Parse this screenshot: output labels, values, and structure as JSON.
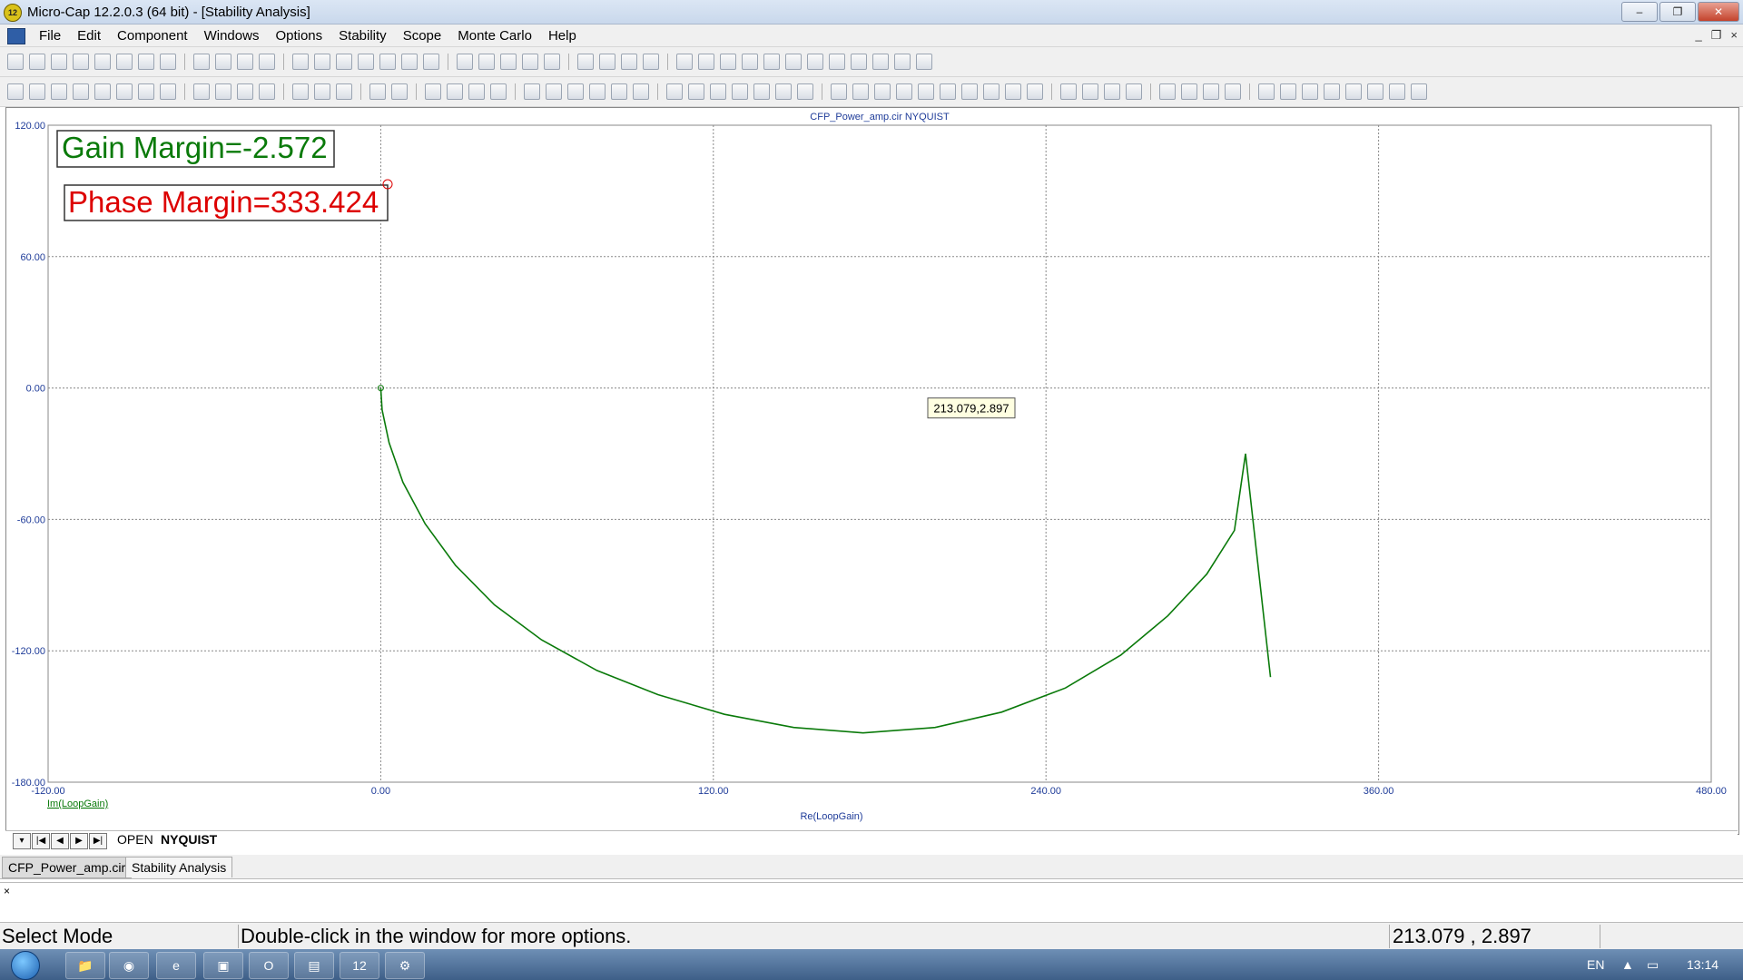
{
  "window": {
    "title": "Micro-Cap 12.2.0.3 (64 bit) - [Stability Analysis]",
    "app_icon_label": "12",
    "buttons": {
      "minimize": "–",
      "restore": "❐",
      "close": "✕"
    }
  },
  "menubar": {
    "items": [
      "File",
      "Edit",
      "Component",
      "Windows",
      "Options",
      "Stability",
      "Scope",
      "Monte Carlo",
      "Help"
    ],
    "mdi_buttons": [
      "_",
      "❐",
      "×"
    ]
  },
  "chart_data": {
    "type": "line",
    "title": "CFP_Power_amp.cir NYQUIST",
    "xlabel": "Re(LoopGain)",
    "ylabel": "Im(LoopGain)",
    "xlim": [
      -120,
      480
    ],
    "ylim": [
      -180,
      120
    ],
    "x_ticks": [
      "-120.00",
      "0.00",
      "120.00",
      "240.00",
      "360.00",
      "480.00"
    ],
    "y_ticks": [
      "120.00",
      "60.00",
      "0.00",
      "-60.00",
      "-120.00",
      "-180.00"
    ],
    "grid": true,
    "series": [
      {
        "name": "Im(LoopGain)",
        "color": "#0a7a0a",
        "x": [
          0,
          0.5,
          3,
          8,
          16,
          27,
          41,
          58,
          78,
          100,
          124,
          149,
          174,
          200,
          224,
          247,
          267,
          284,
          298,
          308,
          312,
          321
        ],
        "y": [
          0,
          -10,
          -25,
          -43,
          -62,
          -81,
          -99,
          -115,
          -129,
          -140,
          -149,
          -155,
          -157.5,
          -155,
          -148,
          -137,
          -122,
          -104,
          -85,
          -65,
          -30,
          -132
        ]
      }
    ],
    "annotations": {
      "gain_margin": "Gain Margin=-2.572",
      "phase_margin": "Phase Margin=333.424",
      "cursor_tooltip": "213.079,2.897",
      "cursor_point": {
        "x": 213.079,
        "y": 2.897
      }
    },
    "colors": {
      "gain_margin": "#0a7a0a",
      "phase_margin": "#dd0000",
      "axis_labels": "#1f3c99"
    }
  },
  "plot_tabs": {
    "nav": [
      "▾",
      "|◀",
      "◀",
      "▶",
      "▶|"
    ],
    "tabs": [
      "OPEN",
      "NYQUIST"
    ],
    "active": "NYQUIST"
  },
  "document_tabs": {
    "items": [
      "CFP_Power_amp.cir",
      "Stability Analysis"
    ],
    "active": "Stability Analysis"
  },
  "command_pane": {
    "close_label": "×"
  },
  "statusbar": {
    "mode": "Select Mode",
    "hint": "Double-click in the window for more options.",
    "coords": "213.079 , 2.897"
  },
  "taskbar": {
    "apps": [
      "📁",
      "◉",
      "e",
      "▣",
      "O",
      "▤",
      "12",
      "⚙"
    ],
    "lang": "EN",
    "time": "13:14"
  }
}
